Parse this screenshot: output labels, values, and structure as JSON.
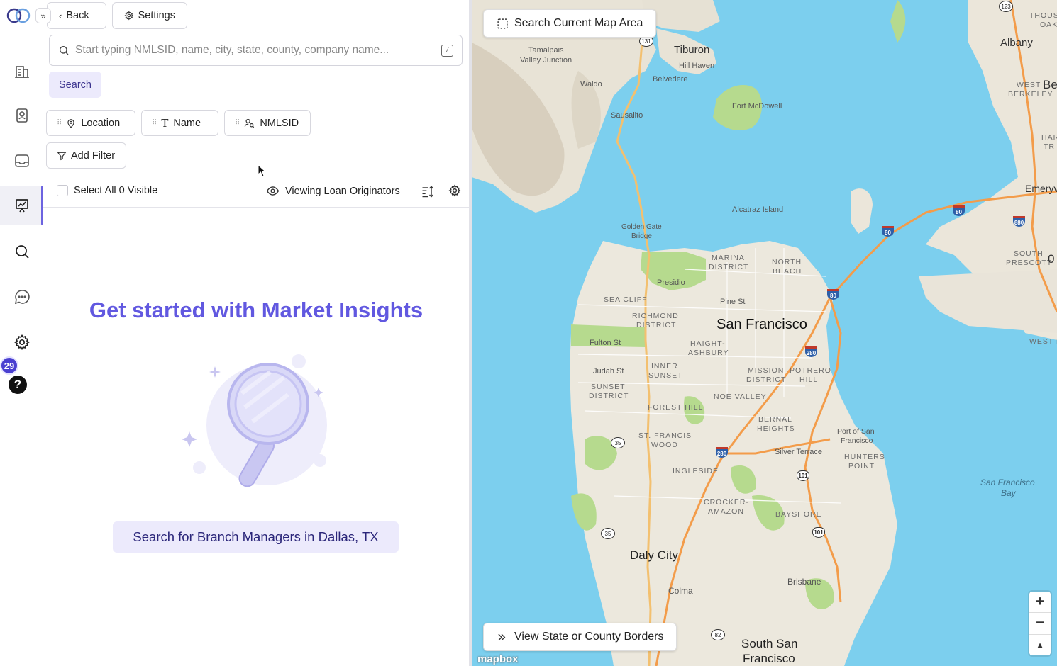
{
  "header": {
    "back_label": "Back",
    "settings_label": "Settings"
  },
  "search": {
    "placeholder": "Start typing NMLSID, name, city, state, county, company name...",
    "kbd_hint": "/",
    "button_label": "Search"
  },
  "filters": {
    "chips": [
      {
        "label": "Location",
        "icon": "map-pin-icon"
      },
      {
        "label": "Name",
        "icon": "text-icon"
      },
      {
        "label": "NMLSID",
        "icon": "id-icon"
      }
    ],
    "add_filter_label": "Add Filter"
  },
  "listbar": {
    "select_all_label": "Select All 0 Visible",
    "viewing_label": "Viewing Loan Originators"
  },
  "empty_state": {
    "title": "Get started with Market Insights",
    "cta_label": "Search for Branch Managers in Dallas, TX"
  },
  "rail": {
    "badge_count": "29",
    "help_label": "?"
  },
  "map": {
    "search_area_label": "Search Current Map Area",
    "borders_label": "View State or County Borders",
    "zoom_in": "+",
    "zoom_out": "−",
    "compass": "▲",
    "attribution": "mapbox",
    "labels": {
      "san_francisco": "San Francisco",
      "daly_city": "Daly City",
      "south_sf_1": "South San",
      "south_sf_2": "Francisco",
      "tiburon": "Tiburon",
      "albany": "Albany",
      "emeryville": "Emeryvill",
      "sausalito": "Sausalito",
      "belvedere": "Belvedere",
      "hill_haven": "Hill Haven",
      "waldo": "Waldo",
      "tamalpais_1": "Tamalpais",
      "tamalpais_2": "Valley Junction",
      "fort_mcdowell": "Fort McDowell",
      "alcatraz": "Alcatraz Island",
      "golden_gate_1": "Golden Gate",
      "golden_gate_2": "Bridge",
      "presidio": "Presidio",
      "marina_1": "MARINA",
      "marina_2": "DISTRICT",
      "north_beach_1": "NORTH",
      "north_beach_2": "BEACH",
      "sea_cliff": "SEA CLIFF",
      "richmond_1": "RICHMOND",
      "richmond_2": "DISTRICT",
      "pine_st": "Pine St",
      "fulton_st": "Fulton St",
      "haight_1": "HAIGHT-",
      "haight_2": "ASHBURY",
      "judah_st": "Judah St",
      "inner_sunset_1": "INNER",
      "inner_sunset_2": "SUNSET",
      "sunset_1": "SUNSET",
      "sunset_2": "DISTRICT",
      "mission_1": "MISSION",
      "mission_2": "DISTRICT",
      "potrero_1": "POTRERO",
      "potrero_2": "HILL",
      "noe_valley": "NOE VALLEY",
      "forest_hill": "FOREST HILL",
      "st_francis_1": "ST. FRANCIS",
      "st_francis_2": "WOOD",
      "bernal_1": "BERNAL",
      "bernal_2": "HEIGHTS",
      "ingleside": "INGLESIDE",
      "silver_terrace": "Silver Terrace",
      "port_sf_1": "Port of San",
      "port_sf_2": "Francisco",
      "hunters_1": "HUNTERS",
      "hunters_2": "POINT",
      "crocker_1": "CROCKER-",
      "crocker_2": "AMAZON",
      "bayshore": "BAYSHORE",
      "colma": "Colma",
      "brisbane": "Brisbane",
      "sf_bay_1": "San Francisco",
      "sf_bay_2": "Bay",
      "west_berkeley_1": "WEST",
      "west_berkeley_2": "BERKELEY",
      "south_prescott_1": "SOUTH",
      "south_prescott_2": "PRESCOTT",
      "west_e": "WEST E",
      "thousand_oaks_1": "THOUS",
      "thousand_oaks_2": "OAK",
      "har": "HAR",
      "tr": "TR",
      "be": "Be",
      "oak": "0"
    },
    "shields": {
      "r131": "131",
      "r123": "123",
      "i80a": "80",
      "i80b": "80",
      "i80c": "80",
      "i880": "880",
      "i280a": "280",
      "i280b": "280",
      "r35a": "35",
      "r35b": "35",
      "us101a": "101",
      "us101b": "101",
      "r82": "82"
    }
  }
}
